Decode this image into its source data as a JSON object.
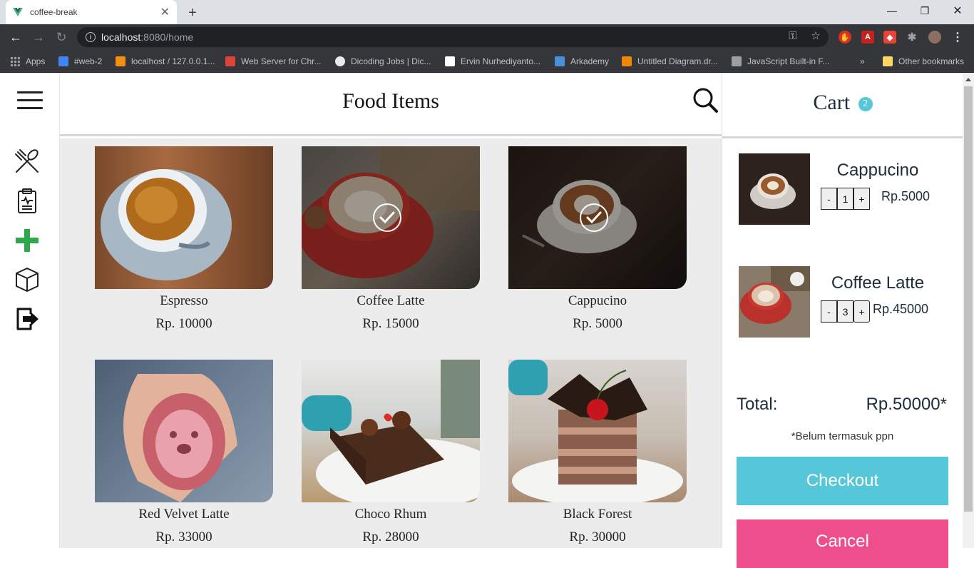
{
  "browser": {
    "tab_title": "coffee-break",
    "url_host": "localhost",
    "url_rest": ":8080/home",
    "bookmarks": [
      {
        "label": "Apps",
        "color": "#bdc1c6"
      },
      {
        "label": "#web-2",
        "color": "#4285f4"
      },
      {
        "label": "localhost / 127.0.0.1...",
        "color": "#f29111"
      },
      {
        "label": "Web Server for Chr...",
        "color": "#db4437"
      },
      {
        "label": "Dicoding Jobs | Dic...",
        "color": "#e8eaed"
      },
      {
        "label": "Ervin Nurhediyanto...",
        "color": "#ffffff"
      },
      {
        "label": "Arkademy",
        "color": "#4a90d9"
      },
      {
        "label": "Untitled Diagram.dr...",
        "color": "#f08705"
      },
      {
        "label": "JavaScript Built-in F...",
        "color": "#9aa0a6"
      }
    ],
    "other_bookmarks": "Other bookmarks"
  },
  "header": {
    "title": "Food Items"
  },
  "sidebar": {
    "icons": [
      "fork-spoon-icon",
      "clipboard-icon",
      "add-icon",
      "box-icon",
      "logout-icon"
    ]
  },
  "items": [
    {
      "name": "Espresso",
      "price": "Rp. 10000",
      "selected": false
    },
    {
      "name": "Coffee Latte",
      "price": "Rp. 15000",
      "selected": true
    },
    {
      "name": "Cappucino",
      "price": "Rp. 5000",
      "selected": true
    },
    {
      "name": "Red Velvet Latte",
      "price": "Rp. 33000",
      "selected": false
    },
    {
      "name": "Choco Rhum",
      "price": "Rp. 28000",
      "selected": false
    },
    {
      "name": "Black Forest",
      "price": "Rp. 30000",
      "selected": false
    }
  ],
  "cart": {
    "title": "Cart",
    "count": "2",
    "items": [
      {
        "name": "Cappucino",
        "qty": "1",
        "price": "Rp.5000",
        "minus": "-",
        "plus": "+"
      },
      {
        "name": "Coffee Latte",
        "qty": "3",
        "price": "Rp.45000",
        "minus": "-",
        "plus": "+"
      }
    ],
    "total_label": "Total:",
    "total_value": "Rp.50000*",
    "note": "*Belum termasuk ppn",
    "checkout_label": "Checkout",
    "cancel_label": "Cancel"
  },
  "colors": {
    "accent": "#56c7d8",
    "cancel": "#ee4f8c",
    "add": "#2ea84a"
  }
}
